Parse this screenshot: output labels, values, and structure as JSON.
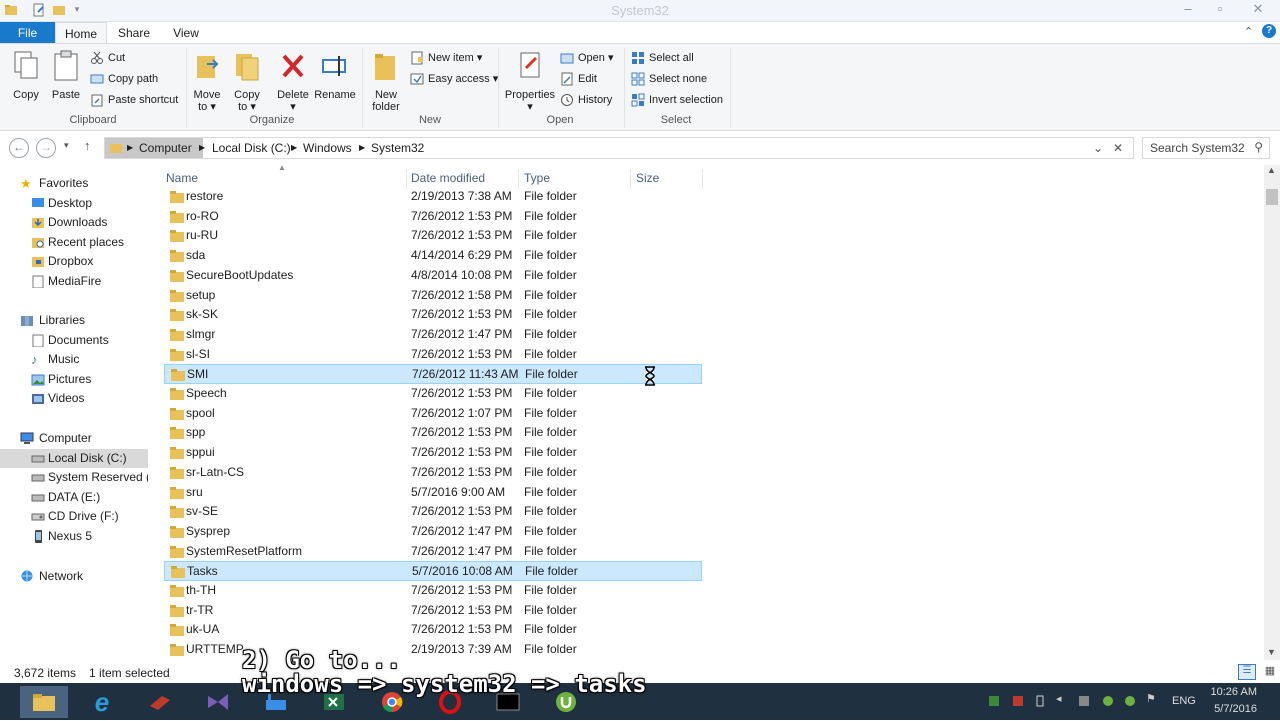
{
  "window": {
    "title": "System32"
  },
  "ribbon_tabs": [
    "File",
    "Home",
    "Share",
    "View"
  ],
  "ribbon": {
    "clipboard": {
      "copy": "Copy",
      "paste": "Paste",
      "cut": "Cut",
      "copy_path": "Copy path",
      "paste_shortcut": "Paste shortcut",
      "label": "Clipboard"
    },
    "organize": {
      "move_to": "Move",
      "move_to2": "to",
      "copy_to": "Copy",
      "copy_to2": "to",
      "delete": "Delete",
      "rename": "Rename",
      "label": "Organize"
    },
    "new": {
      "new_folder": "New",
      "new_folder2": "folder",
      "new_item": "New item",
      "easy_access": "Easy access",
      "label": "New"
    },
    "open": {
      "properties": "Properties",
      "open": "Open",
      "edit": "Edit",
      "history": "History",
      "label": "Open"
    },
    "select": {
      "select_all": "Select all",
      "select_none": "Select none",
      "invert": "Invert selection",
      "label": "Select"
    }
  },
  "address": {
    "crumbs": [
      "Computer",
      "Local Disk (C:)",
      "Windows",
      "System32"
    ],
    "search_placeholder": "Search System32"
  },
  "nav": {
    "favorites": "Favorites",
    "fav_items": [
      "Desktop",
      "Downloads",
      "Recent places",
      "Dropbox",
      "MediaFire"
    ],
    "libraries": "Libraries",
    "lib_items": [
      "Documents",
      "Music",
      "Pictures",
      "Videos"
    ],
    "computer": "Computer",
    "comp_items": [
      "Local Disk (C:)",
      "System Reserved (D:",
      "DATA (E:)",
      "CD Drive (F:)",
      "Nexus 5"
    ],
    "network": "Network"
  },
  "columns": {
    "name": "Name",
    "date": "Date modified",
    "type": "Type",
    "size": "Size"
  },
  "files": [
    {
      "name": "restore",
      "date": "2/19/2013 7:38 AM",
      "type": "File folder"
    },
    {
      "name": "ro-RO",
      "date": "7/26/2012 1:53 PM",
      "type": "File folder"
    },
    {
      "name": "ru-RU",
      "date": "7/26/2012 1:53 PM",
      "type": "File folder"
    },
    {
      "name": "sda",
      "date": "4/14/2014 6:29 PM",
      "type": "File folder"
    },
    {
      "name": "SecureBootUpdates",
      "date": "4/8/2014 10:08 PM",
      "type": "File folder"
    },
    {
      "name": "setup",
      "date": "7/26/2012 1:58 PM",
      "type": "File folder"
    },
    {
      "name": "sk-SK",
      "date": "7/26/2012 1:53 PM",
      "type": "File folder"
    },
    {
      "name": "slmgr",
      "date": "7/26/2012 1:47 PM",
      "type": "File folder"
    },
    {
      "name": "sl-SI",
      "date": "7/26/2012 1:53 PM",
      "type": "File folder"
    },
    {
      "name": "SMI",
      "date": "7/26/2012 11:43 AM",
      "type": "File folder"
    },
    {
      "name": "Speech",
      "date": "7/26/2012 1:53 PM",
      "type": "File folder"
    },
    {
      "name": "spool",
      "date": "7/26/2012 1:07 PM",
      "type": "File folder"
    },
    {
      "name": "spp",
      "date": "7/26/2012 1:53 PM",
      "type": "File folder"
    },
    {
      "name": "sppui",
      "date": "7/26/2012 1:53 PM",
      "type": "File folder"
    },
    {
      "name": "sr-Latn-CS",
      "date": "7/26/2012 1:53 PM",
      "type": "File folder"
    },
    {
      "name": "sru",
      "date": "5/7/2016 9:00 AM",
      "type": "File folder"
    },
    {
      "name": "sv-SE",
      "date": "7/26/2012 1:53 PM",
      "type": "File folder"
    },
    {
      "name": "Sysprep",
      "date": "7/26/2012 1:47 PM",
      "type": "File folder"
    },
    {
      "name": "SystemResetPlatform",
      "date": "7/26/2012 1:47 PM",
      "type": "File folder"
    },
    {
      "name": "Tasks",
      "date": "5/7/2016 10:08 AM",
      "type": "File folder"
    },
    {
      "name": "th-TH",
      "date": "7/26/2012 1:53 PM",
      "type": "File folder"
    },
    {
      "name": "tr-TR",
      "date": "7/26/2012 1:53 PM",
      "type": "File folder"
    },
    {
      "name": "uk-UA",
      "date": "7/26/2012 1:53 PM",
      "type": "File folder"
    },
    {
      "name": "URTTEMP",
      "date": "2/19/2013 7:39 AM",
      "type": "File folder"
    }
  ],
  "status": {
    "count": "3,672 items",
    "selected": "1 item selected"
  },
  "caption": {
    "line1": "2) Go to...",
    "line2": "windows => system32 => tasks"
  },
  "clock": {
    "time": "10:26 AM",
    "date": "5/7/2016"
  },
  "tray": {
    "lang": "ENG"
  },
  "colors": {
    "accent": "#1979ca",
    "selection": "#cce8ff",
    "selection_border": "#99d1ff",
    "folder": "#e8c15a",
    "taskbar": "#1f3040"
  }
}
